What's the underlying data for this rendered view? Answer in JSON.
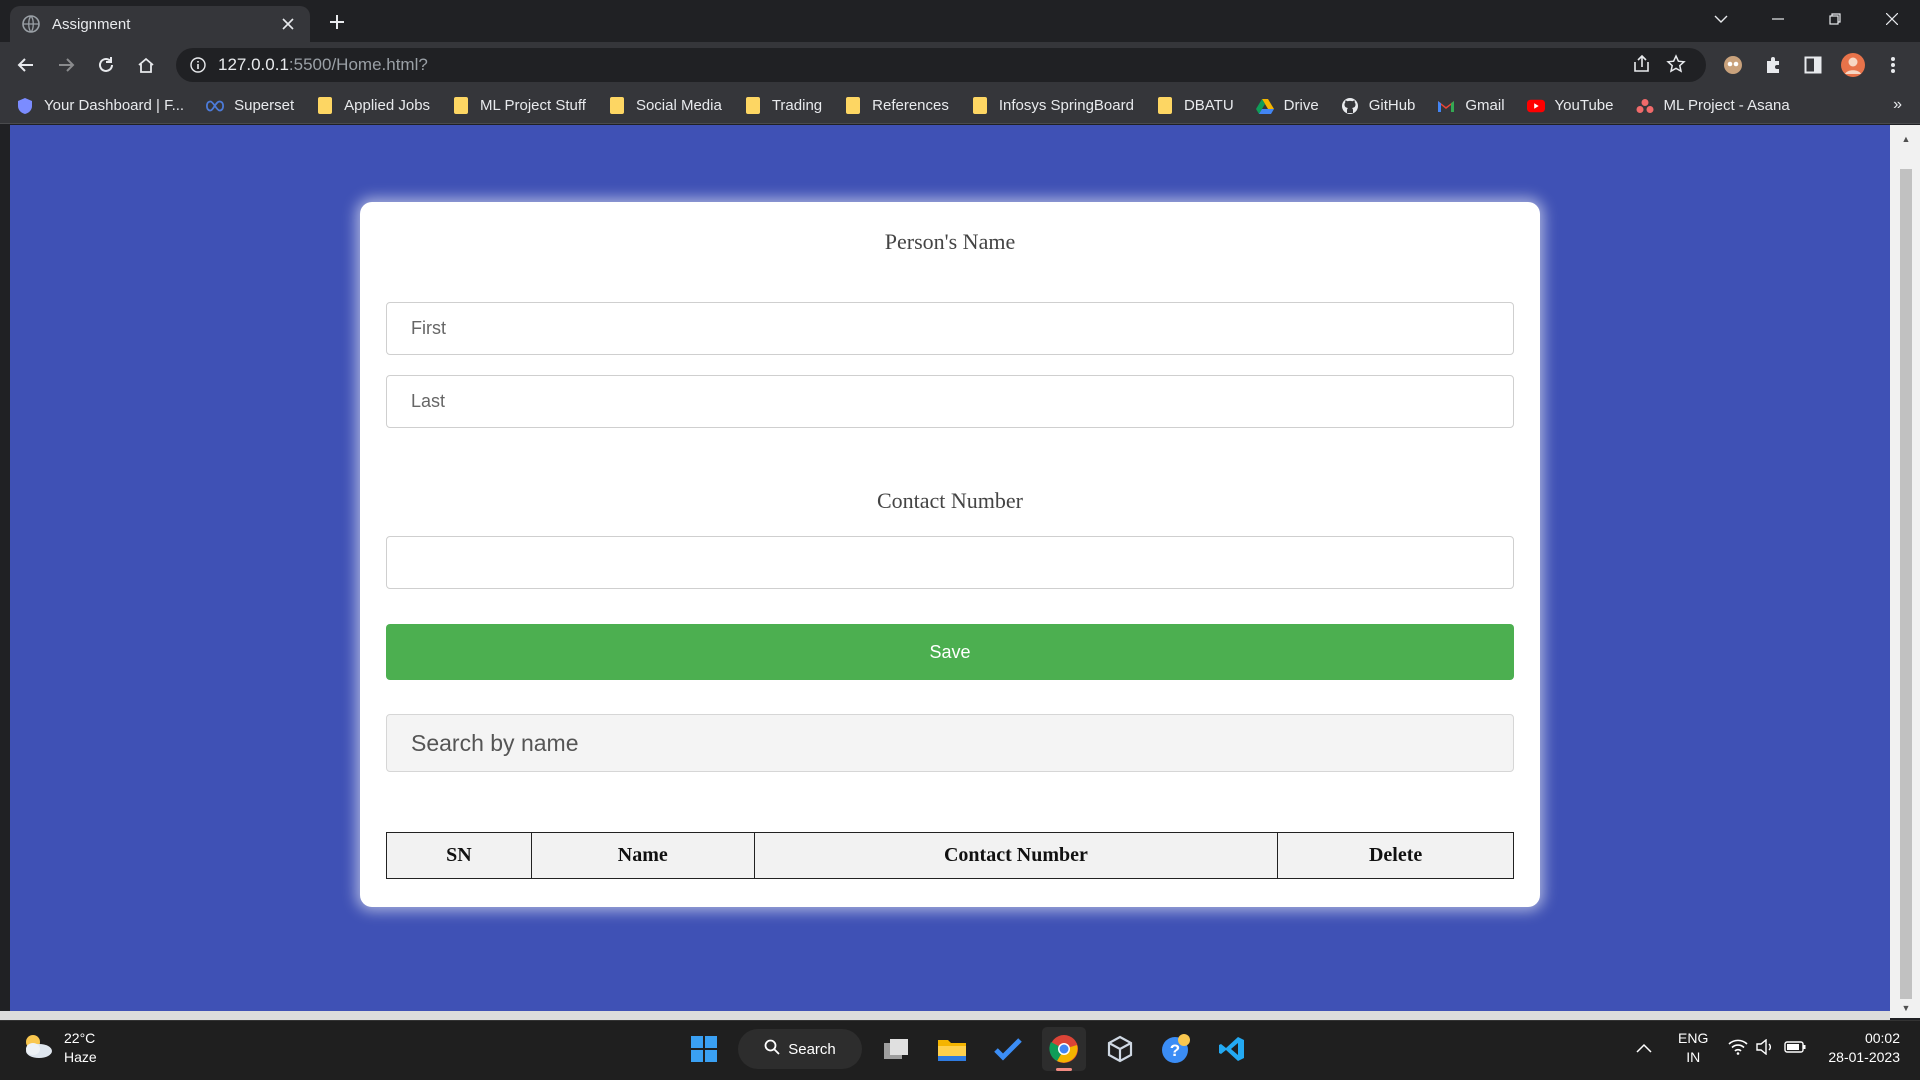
{
  "browser": {
    "tab_title": "Assignment",
    "url_host": "127.0.0.1",
    "url_path": ":5500/Home.html?"
  },
  "bookmarks": [
    {
      "label": "Your Dashboard | F...",
      "icon": "shield-icon"
    },
    {
      "label": "Superset",
      "icon": "superset-icon"
    },
    {
      "label": "Applied Jobs",
      "icon": "folder-icon"
    },
    {
      "label": "ML Project Stuff",
      "icon": "folder-icon"
    },
    {
      "label": "Social Media",
      "icon": "folder-icon"
    },
    {
      "label": "Trading",
      "icon": "folder-icon"
    },
    {
      "label": "References",
      "icon": "folder-icon"
    },
    {
      "label": "Infosys SpringBoard",
      "icon": "folder-icon"
    },
    {
      "label": "DBATU",
      "icon": "folder-icon"
    },
    {
      "label": "Drive",
      "icon": "drive-icon"
    },
    {
      "label": "GitHub",
      "icon": "github-icon"
    },
    {
      "label": "Gmail",
      "icon": "gmail-icon"
    },
    {
      "label": "YouTube",
      "icon": "youtube-icon"
    },
    {
      "label": "ML Project - Asana",
      "icon": "asana-icon"
    }
  ],
  "bookmarks_more": "»",
  "form": {
    "name_heading": "Person's Name",
    "first_placeholder": "First",
    "last_placeholder": "Last",
    "contact_heading": "Contact Number",
    "contact_value": "",
    "save_label": "Save",
    "search_placeholder": "Search by name"
  },
  "table": {
    "columns": [
      "SN",
      "Name",
      "Contact Number",
      "Delete"
    ],
    "rows": []
  },
  "taskbar": {
    "temperature": "22°C",
    "condition": "Haze",
    "search_label": "Search",
    "lang_top": "ENG",
    "lang_bottom": "IN",
    "time": "00:02",
    "date": "28-01-2023"
  },
  "colors": {
    "page_background": "#3f51b5",
    "save_button": "#4caf50"
  }
}
